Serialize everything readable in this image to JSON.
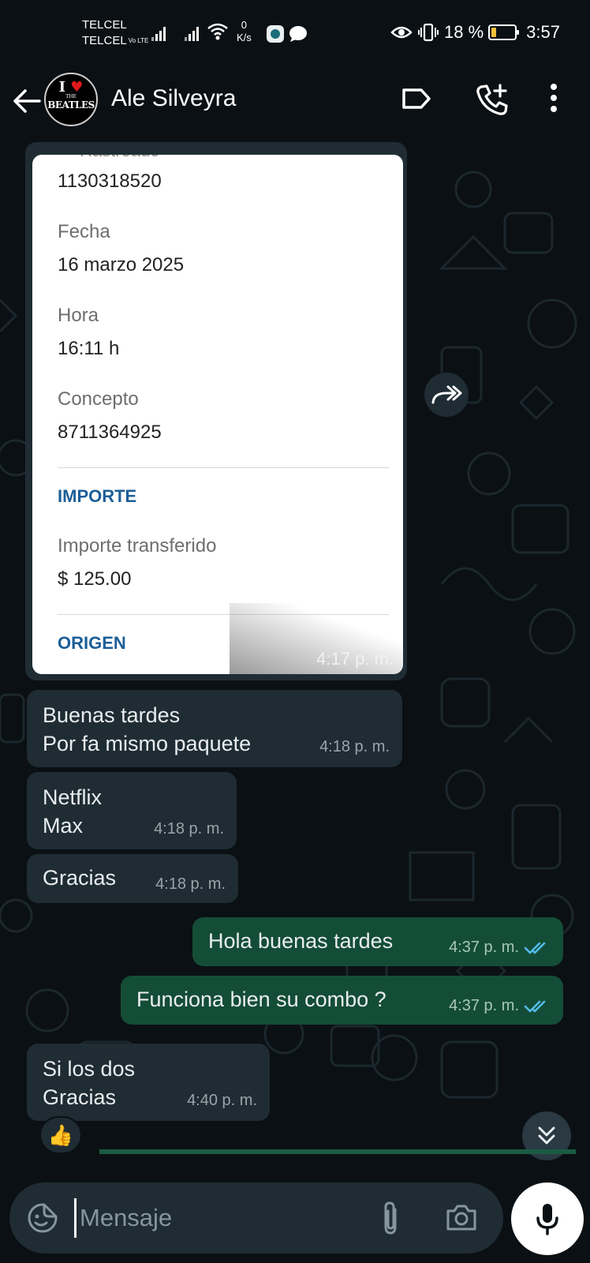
{
  "status_bar": {
    "carrier_1": "TELCEL",
    "carrier_2": "TELCEL",
    "volte": "Vo LTE",
    "net_speed_value": "0",
    "net_speed_unit": "K/s",
    "battery": "18 %",
    "time": "3:57"
  },
  "header": {
    "contact_name": "Ale Silveyra",
    "avatar_line1": "I",
    "avatar_line2": "THE",
    "avatar_line3": "BEATLES"
  },
  "receipt": {
    "cut_label": "Rastreado",
    "tracking_value": "1130318520",
    "date_label": "Fecha",
    "date_value": "16 marzo 2025",
    "hour_label": "Hora",
    "hour_value": "16:11 h",
    "concept_label": "Concepto",
    "concept_value": "8711364925",
    "amount_section": "IMPORTE",
    "transferred_label": "Importe transferido",
    "transferred_value": "$ 125.00",
    "origin_section": "ORIGEN",
    "time": "4:17 p. m."
  },
  "messages": [
    {
      "dir": "in",
      "line1": "Buenas tardes",
      "line2": "Por fa mismo paquete",
      "time": "4:18 p. m."
    },
    {
      "dir": "in",
      "line1": "Netflix",
      "line2": "Max",
      "time": "4:18 p. m."
    },
    {
      "dir": "in",
      "line1": "Gracias",
      "time": "4:18 p. m."
    },
    {
      "dir": "out",
      "line1": "Hola buenas tardes",
      "time": "4:37 p. m.",
      "status": "read"
    },
    {
      "dir": "out",
      "line1": "Funciona bien su combo ?",
      "time": "4:37 p. m.",
      "status": "read"
    },
    {
      "dir": "in",
      "line1": "Si los dos",
      "line2": "Gracias",
      "time": "4:40 p. m.",
      "reaction": "👍"
    }
  ],
  "composer": {
    "placeholder": "Mensaje"
  },
  "icons": {
    "back": "arrow-left-icon",
    "label": "label-tag-icon",
    "call_add": "add-call-icon",
    "menu": "more-vert-icon",
    "forward": "forward-icon",
    "scroll": "double-chevron-down-icon",
    "emoji": "sticker-icon",
    "attach": "paperclip-icon",
    "camera": "camera-icon",
    "mic": "microphone-icon"
  },
  "colors": {
    "background": "#0b1014",
    "incoming_bubble": "#1f2c34",
    "outgoing_bubble": "#144d37",
    "read_ticks": "#53bdeb",
    "section_blue": "#1c5e98"
  }
}
